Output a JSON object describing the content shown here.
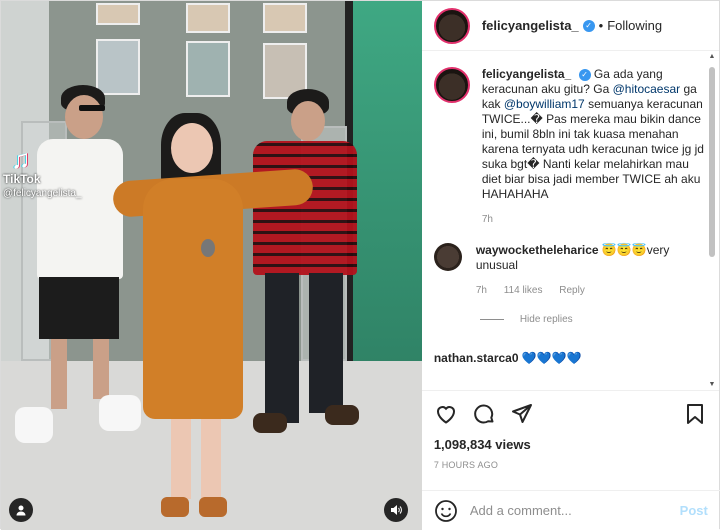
{
  "post": {
    "username": "felicyangelista_",
    "follow_state": "Following",
    "separator": "•"
  },
  "video": {
    "watermark_logo": "TikTok",
    "watermark_handle": "@felicyangelista_"
  },
  "caption": {
    "username": "felicyangelista_",
    "parts": [
      "Ga ada yang keracunan aku gitu? Ga ",
      "@hitocaesar",
      " ga kak ",
      "@boywilliam17",
      " semuanya keracunan TWICE...� Pas mereka mau bikin dance ini, bumil 8bln ini tak kuasa menahan karena ternyata udh keracunan twice jg jd suka bgt� Nanti kelar melahirkan mau diet biar bisa jadi member TWICE ah aku HAHAHAHA"
    ],
    "time": "7h"
  },
  "comment": {
    "username": "waywocketheleharice",
    "text": " 😇😇😇very unusual",
    "time": "7h",
    "likes": "114 likes",
    "reply": "Reply",
    "hide_replies": "Hide replies"
  },
  "partial_comment": "nathan.starca0 💙💙💙💙",
  "stats": {
    "views": "1,098,834 views",
    "posted": "7 HOURS AGO"
  },
  "add_comment": {
    "placeholder": "Add a comment...",
    "post_label": "Post"
  },
  "icons": [
    "heart-icon",
    "comment-icon",
    "share-icon",
    "bookmark-icon",
    "emoji-icon",
    "user-tag-icon",
    "sound-icon"
  ],
  "colors": {
    "verified": "#3897f0",
    "link": "#00376b",
    "muted": "#8e8e8e",
    "post_disabled": "#b2dffc"
  }
}
